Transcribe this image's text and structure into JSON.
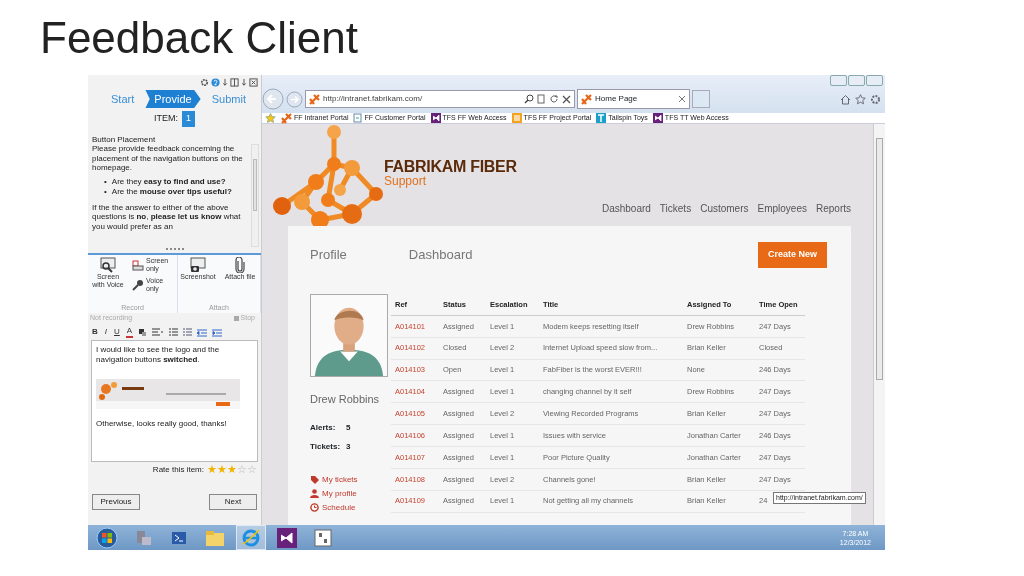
{
  "slide_title": "Feedback Client",
  "feedback_panel": {
    "steps": [
      {
        "label": "Start",
        "selected": false
      },
      {
        "label": "Provide",
        "selected": true
      },
      {
        "label": "Submit",
        "selected": false
      }
    ],
    "item_label": "ITEM:",
    "item_number": "1",
    "heading": "Button Placement",
    "paragraph": "Please provide feedback concerning the placement of the navigation buttons on the homepage.",
    "bullets": [
      {
        "marker": "•",
        "text": "Are they **easy to find and use?**"
      },
      {
        "marker": "•",
        "text": "Are the **mouse over tips useful?**"
      }
    ],
    "closing": "If the the answer to either of the above questions is **no**, **please let us know** what you would prefer as an",
    "ribbon_groups": [
      {
        "label": "Record",
        "buttons": [
          {
            "label": "Screen with Voice",
            "kind": "large"
          },
          {
            "label": "Screen only",
            "kind": "small"
          },
          {
            "label": "Voice only",
            "kind": "small"
          }
        ]
      },
      {
        "label": "Attach",
        "buttons": [
          {
            "label": "Screenshot",
            "kind": "large"
          },
          {
            "label": "Attach file",
            "kind": "large"
          }
        ]
      }
    ],
    "recording_status": "Not recording",
    "stop_label": "Stop",
    "format_buttons": [
      {
        "label": "B",
        "kind": "bold"
      },
      {
        "label": "I",
        "kind": "italic"
      },
      {
        "label": "U",
        "kind": "underline"
      },
      {
        "label": "A",
        "kind": "color"
      }
    ],
    "editor_paragraphs": [
      "I would like to see the logo and the navigation buttons **switched**.",
      "Otherwise, looks really good, thanks!"
    ],
    "rating": {
      "label": "Rate this item:",
      "stars": 3
    },
    "buttons": [
      "Previous",
      "Next"
    ]
  },
  "browser": {
    "address": "http://intranet.fabrikam.com/",
    "tab": "Home Page",
    "favorites": [
      {
        "label": "FF Intranet Portal",
        "kind": "site"
      },
      {
        "label": "FF Customer Portal",
        "kind": "page"
      },
      {
        "label": "TFS FF Web Access",
        "kind": "vs"
      },
      {
        "label": "TFS FF Project Portal",
        "kind": "portal"
      },
      {
        "label": "Tailspin Toys",
        "kind": "tailspin"
      },
      {
        "label": "TFS TT Web Access",
        "kind": "vs"
      }
    ],
    "site": {
      "brand": "FABRIKAM FIBER",
      "subbrand": "Support",
      "nav": [
        "Dashboard",
        "Tickets",
        "Customers",
        "Employees",
        "Reports"
      ],
      "profile_heading": "Profile",
      "dashboard_heading": "Dashboard",
      "create_button": "Create New",
      "user_name": "Drew Robbins",
      "stats": [
        {
          "label": "Alerts:",
          "value": "5"
        },
        {
          "label": "Tickets:",
          "value": "3"
        }
      ],
      "links": [
        {
          "label": "My tickets",
          "kind": "tag"
        },
        {
          "label": "My profile",
          "kind": "person"
        },
        {
          "label": "Schedule",
          "kind": "clock"
        }
      ],
      "table": {
        "columns": [
          "Ref",
          "Status",
          "Escalation",
          "Title",
          "Assigned To",
          "Time Open"
        ],
        "rows": [
          [
            "A014101",
            "Assigned",
            "Level 1",
            "Modem keeps resetting itself",
            "Drew Robbins",
            "247 Days"
          ],
          [
            "A014102",
            "Closed",
            "Level 2",
            "Internet Upload speed slow from...",
            "Brian Keller",
            "Closed"
          ],
          [
            "A014103",
            "Open",
            "Level 1",
            "FabFiber is the worst EVER!!!",
            "None",
            "246 Days"
          ],
          [
            "A014104",
            "Assigned",
            "Level 1",
            "changing channel by it self",
            "Drew Robbins",
            "247 Days"
          ],
          [
            "A014105",
            "Assigned",
            "Level 2",
            "Viewing Recorded Programs",
            "Brian Keller",
            "247 Days"
          ],
          [
            "A014106",
            "Assigned",
            "Level 1",
            "Issues with service",
            "Jonathan Carter",
            "246 Days"
          ],
          [
            "A014107",
            "Assigned",
            "Level 1",
            "Poor Picture Quality",
            "Jonathan Carter",
            "247 Days"
          ],
          [
            "A014108",
            "Assigned",
            "Level 2",
            "Channels gone!",
            "Brian Keller",
            "247 Days"
          ],
          [
            "A014109",
            "Assigned",
            "Level 1",
            "Not getting all my channels",
            "Brian Keller",
            "24"
          ]
        ]
      }
    },
    "status_tooltip": "http://intranet.fabrikam.com/"
  },
  "taskbar": {
    "time": "7:28 AM",
    "date": "12/3/2012"
  }
}
